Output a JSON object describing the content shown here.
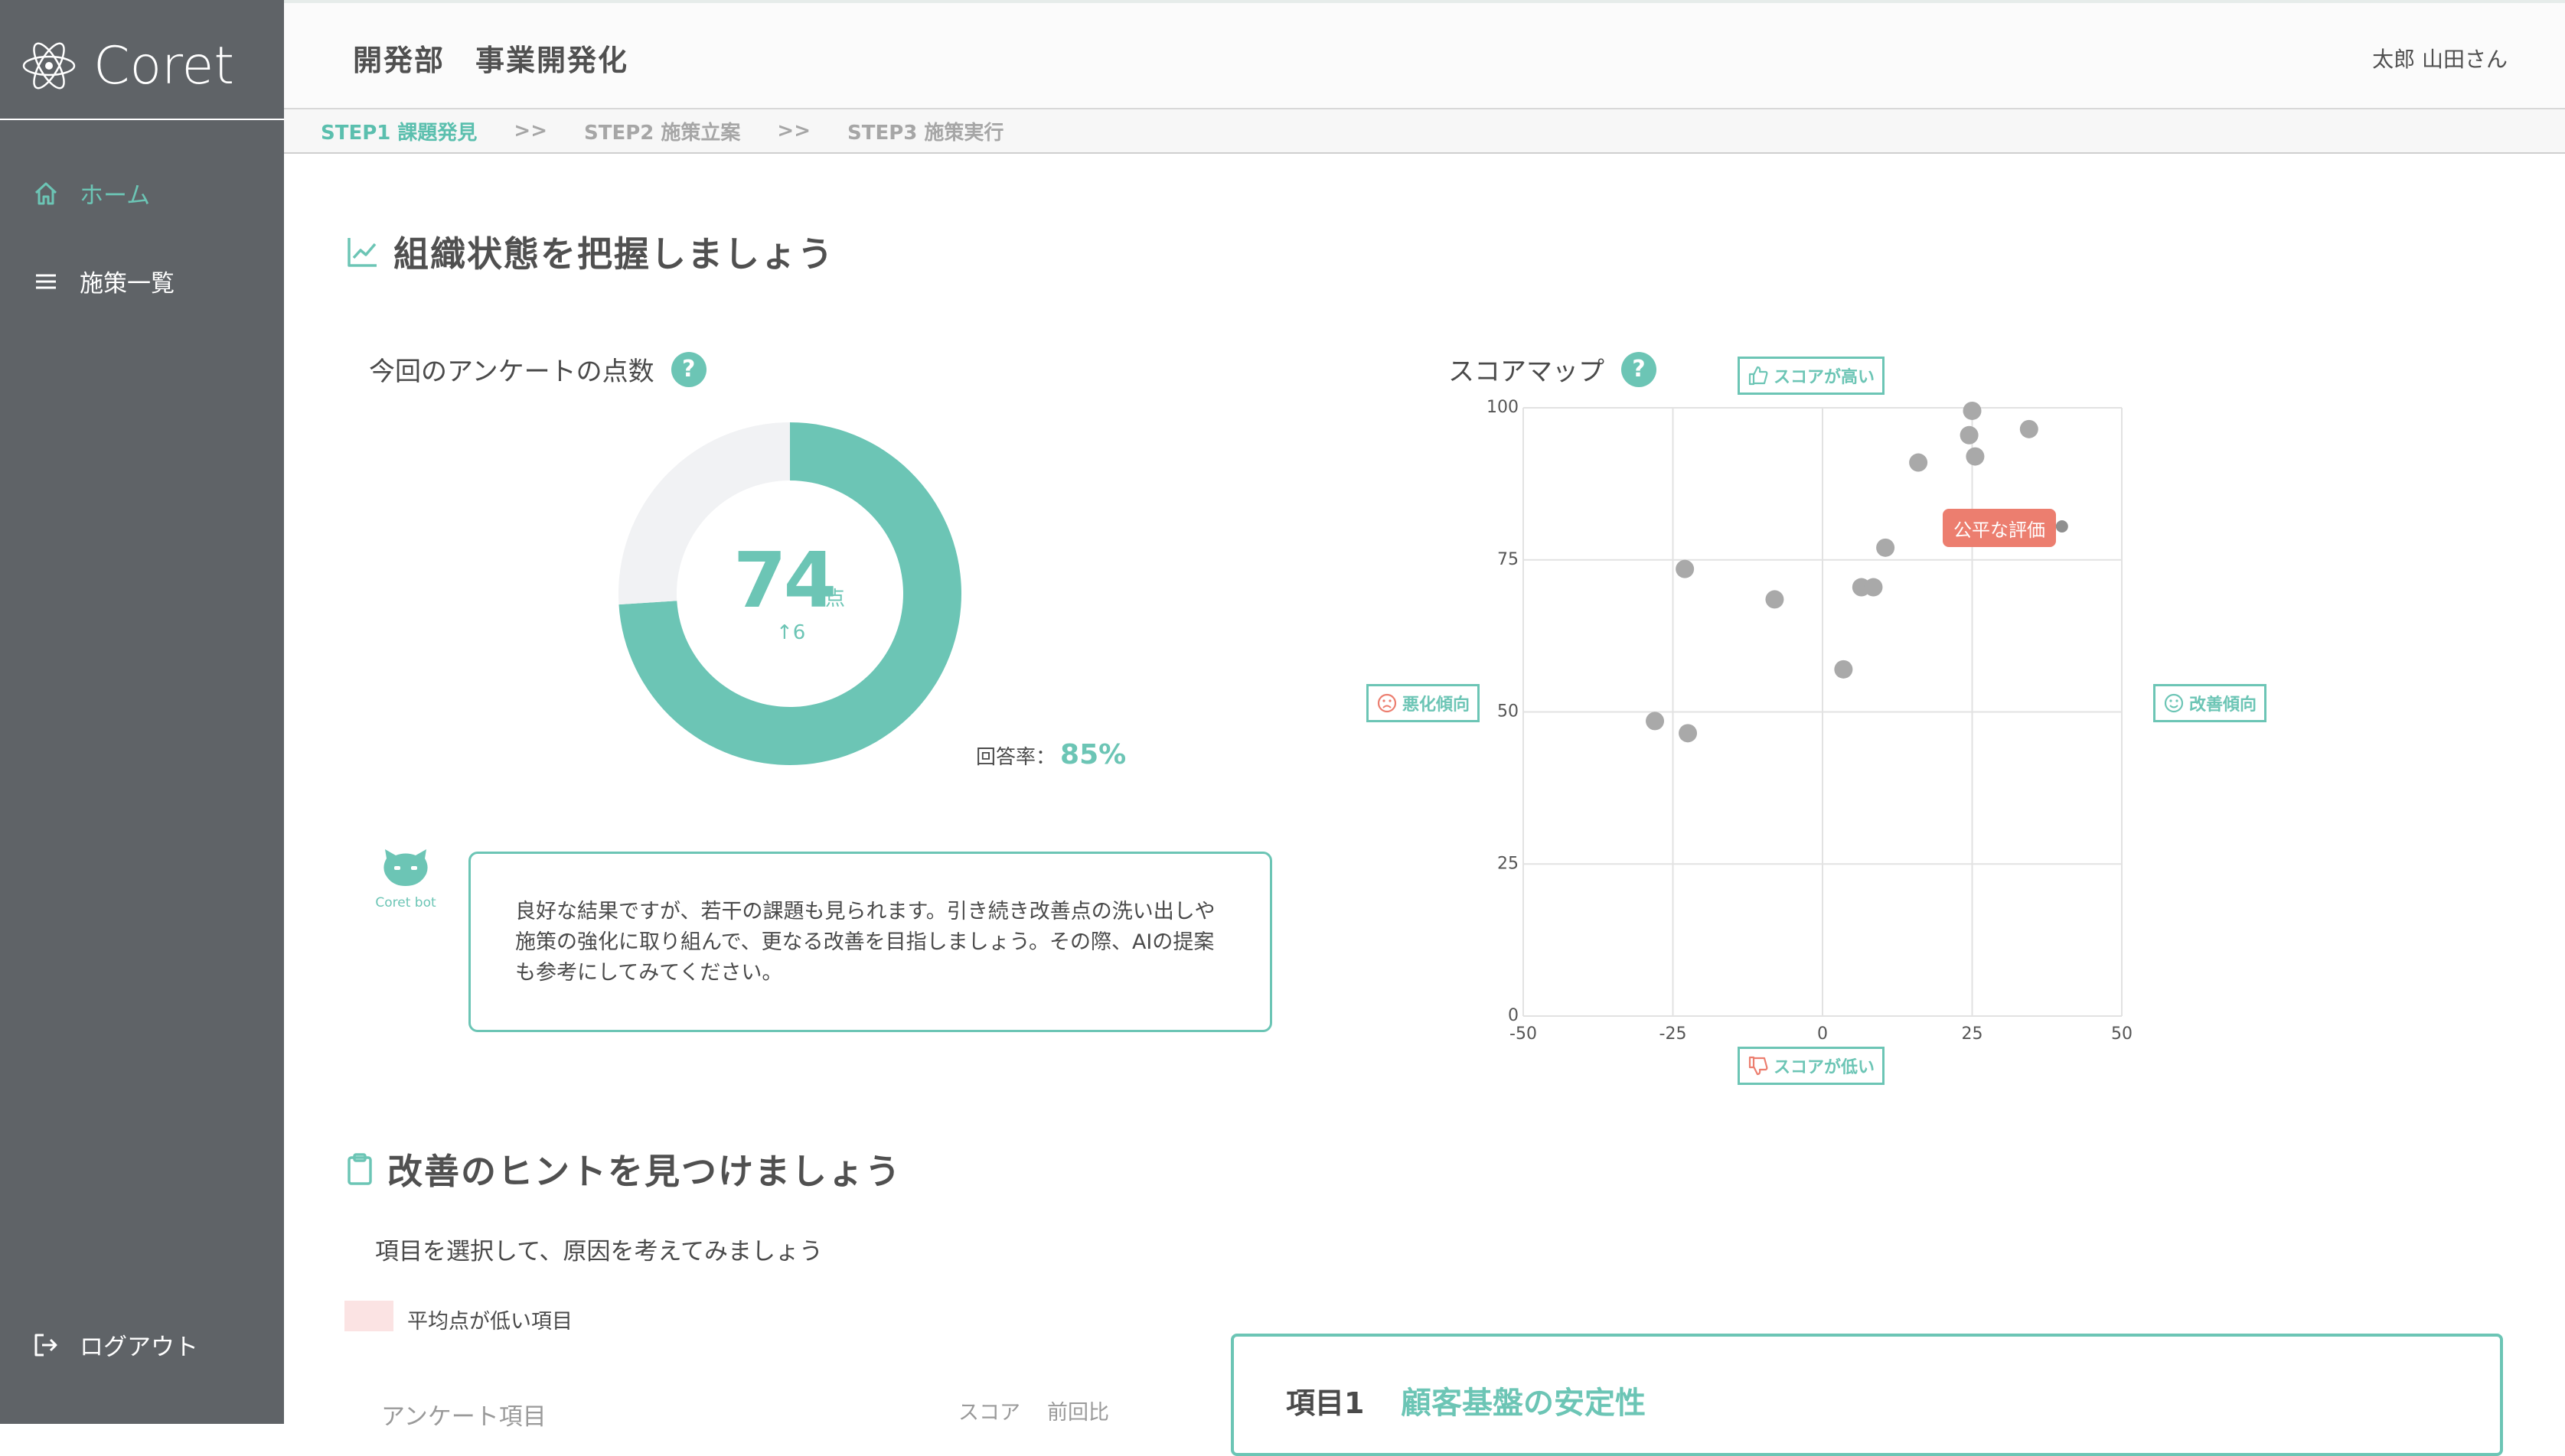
{
  "app": {
    "logo_text": "Coret"
  },
  "sidebar": {
    "items": [
      {
        "label": "ホーム",
        "icon": "home-icon",
        "active": true
      },
      {
        "label": "施策一覧",
        "icon": "list-icon",
        "active": false
      }
    ],
    "logout_label": "ログアウト"
  },
  "header": {
    "department": "開発部　事業開発化",
    "user": "太郎 山田さん"
  },
  "steps": {
    "items": [
      "STEP1 課題発見",
      "STEP2 施策立案",
      "STEP3 施策実行"
    ],
    "separator": ">>",
    "active_index": 0
  },
  "section1": {
    "title": "組織状態を把握しましょう",
    "score_title": "今回のアンケートの点数",
    "score": "74",
    "score_unit": "点",
    "score_diff": "↑6",
    "response_label": "回答率：",
    "response_rate": "85%",
    "bot_label": "Coret bot",
    "bot_message": "良好な結果ですが、若干の課題も見られます。引き続き改善点の洗い出しや施策の強化に取り組んで、更なる改善を目指しましょう。その際、AIの提案も参考にしてみてください。"
  },
  "score_map": {
    "title": "スコアマップ",
    "tag_high": "スコアが高い",
    "tag_low": "スコアが低い",
    "tag_worse": "悪化傾向",
    "tag_better": "改善傾向",
    "tooltip": "公平な評価"
  },
  "section2": {
    "title": "改善のヒントを見つけましょう",
    "description": "項目を選択して、原因を考えてみましょう",
    "legend_low": "平均点が低い項目",
    "table_headers": {
      "item": "アンケート項目",
      "score": "スコア",
      "prev": "前回比"
    },
    "detail_number": "項目1",
    "detail_name": "顧客基盤の安定性"
  },
  "colors": {
    "accent": "#6cc5b5",
    "sidebar": "#5f6367",
    "warning": "#ec7e6f",
    "point": "#a9a9a9"
  },
  "chart_data": [
    {
      "type": "pie",
      "categories": [
        "score",
        "remaining"
      ],
      "values": [
        74,
        26
      ]
    },
    {
      "type": "scatter",
      "xlim": [
        -50,
        50
      ],
      "ylim": [
        0,
        100
      ],
      "xticks": [
        -50,
        -25,
        0,
        25,
        50
      ],
      "yticks": [
        0,
        25,
        50,
        75,
        100
      ],
      "grid": true,
      "series": [
        {
          "x": [
            -28,
            -22.5,
            -23,
            -8,
            3.5,
            6.5,
            8.5,
            10.5,
            16,
            24.5,
            25,
            25.5,
            34.5,
            40
          ],
          "y": [
            48.5,
            46.5,
            73.5,
            68.5,
            57,
            70.5,
            70.5,
            77,
            91,
            95.5,
            99.5,
            92,
            96.5,
            80.5
          ]
        }
      ]
    }
  ]
}
